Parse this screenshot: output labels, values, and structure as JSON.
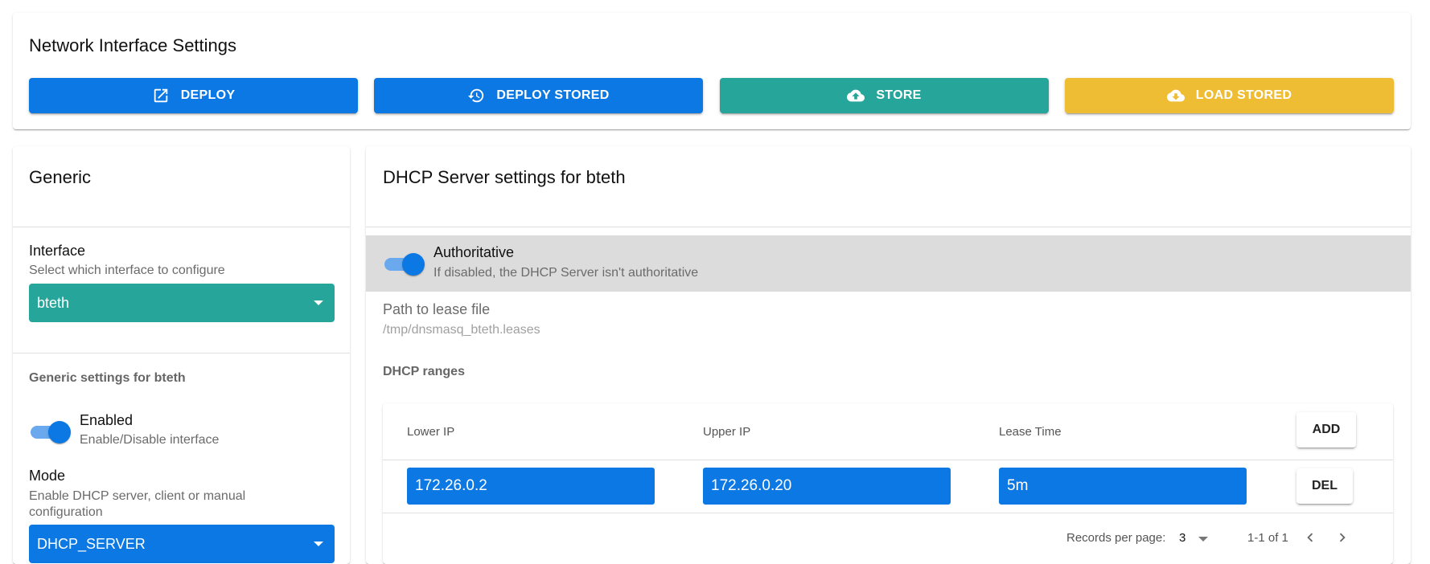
{
  "header": {
    "title": "Network Interface Settings",
    "buttons": {
      "deploy": "DEPLOY",
      "deploy_stored": "DEPLOY STORED",
      "store": "STORE",
      "load_stored": "LOAD STORED"
    }
  },
  "generic": {
    "title": "Generic",
    "interface_label": "Interface",
    "interface_hint": "Select which interface to configure",
    "interface_value": "bteth",
    "settings_header": "Generic settings for bteth",
    "enabled_label": "Enabled",
    "enabled_hint": "Enable/Disable interface",
    "enabled": true,
    "mode_label": "Mode",
    "mode_hint": "Enable DHCP server, client or manual configuration",
    "mode_value": "DHCP_SERVER"
  },
  "dhcp": {
    "title": "DHCP Server settings for bteth",
    "authoritative_label": "Authoritative",
    "authoritative_hint": "If disabled, the DHCP Server isn't authoritative",
    "authoritative": true,
    "lease_file_label": "Path to lease file",
    "lease_file_value": "/tmp/dnsmasq_bteth.leases",
    "ranges_header": "DHCP ranges",
    "columns": [
      "Lower IP",
      "Upper IP",
      "Lease Time"
    ],
    "add_label": "ADD",
    "rows": [
      {
        "lower": "172.26.0.2",
        "upper": "172.26.0.20",
        "lease": "5m",
        "del_label": "DEL"
      }
    ],
    "footer": {
      "records_per_page_label": "Records per page:",
      "records_per_page_value": "3",
      "range_text": "1-1 of 1"
    }
  },
  "colors": {
    "primary": "#0c78e4",
    "teal": "#26a69a",
    "amber": "#efbd34"
  }
}
